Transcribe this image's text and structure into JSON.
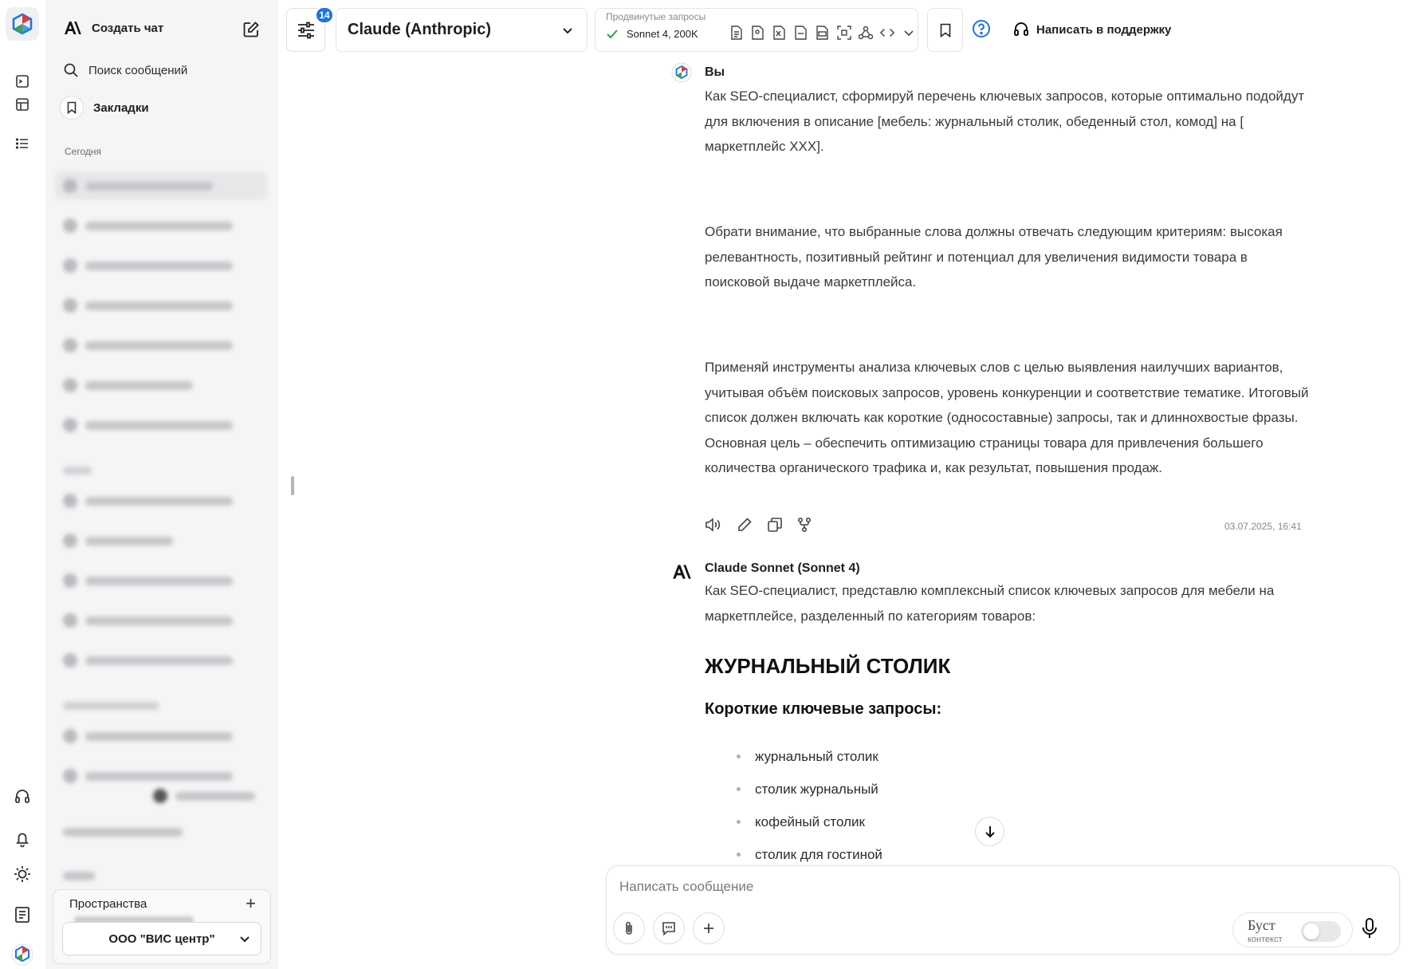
{
  "rail": {
    "icons": [
      "app-logo",
      "terminal-icon",
      "table-icon",
      "list-icon",
      "headset-icon",
      "bell-icon",
      "sun-icon",
      "document-icon",
      "brand-logo"
    ]
  },
  "sidebar": {
    "new_chat_label": "Создать чат",
    "search_label": "Поиск сообщений",
    "bookmarks_label": "Закладки",
    "section_today": "Сегодня",
    "spaces": {
      "title": "Пространства",
      "org": "ООО \"ВИС центр\""
    }
  },
  "toolbar": {
    "badge_count": "14",
    "model_name": "Claude (Anthropic)",
    "advanced_label": "Продвинутые запросы",
    "advanced_model": "Sonnet 4, 200K",
    "support_label": "Написать в поддержку"
  },
  "chat": {
    "user_author": "Вы",
    "user_paragraphs": [
      "Как SEO-специалист, сформируй перечень ключевых запросов, которые оптимально подойдут для включения в описание [мебель: журнальный столик, обеденный стол, комод] на [ маркетплейс XXX].",
      "Обрати внимание, что выбранные слова должны отвечать следующим критериям: высокая релевантность, позитивный рейтинг и потенциал для увеличения видимости товара в поисковой выдаче маркетплейса.",
      "Применяй инструменты анализа ключевых слов с целью выявления наилучших вариантов, учитывая объём поисковых запросов, уровень конкуренции и соответствие тематике. Итоговый список должен включать как короткие (односоставные) запросы, так и длиннохвостые фразы. Основная цель – обеспечить оптимизацию страницы товара для привлечения большего количества органического трафика и, как результат, повышения продаж."
    ],
    "timestamp": "03.07.2025, 16:41",
    "assistant_author": "Claude Sonnet (Sonnet 4)",
    "assistant_intro": "Как SEO-специалист, представлю комплексный список ключевых запросов для мебели на маркетплейсе, разделенный по категориям товаров:",
    "heading": "ЖУРНАЛЬНЫЙ СТОЛИК",
    "subheading": "Короткие ключевые запросы:",
    "bullets": [
      "журнальный столик",
      "столик журнальный",
      "кофейный столик",
      "столик для гостиной"
    ]
  },
  "composer": {
    "placeholder": "Написать сообщение",
    "boost_label": "Буст",
    "boost_sub": "контекст"
  },
  "colors": {
    "accent": "#1a73e8",
    "sidebar_bg": "#f5f5f6",
    "check": "#2e9e4f"
  }
}
